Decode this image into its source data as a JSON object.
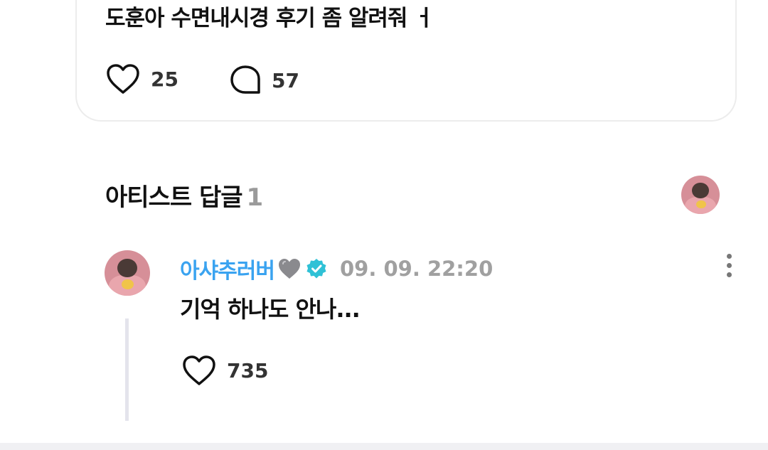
{
  "post": {
    "text": "도훈아 수면내시경 후기 좀 알려줘 ㅓ",
    "like_count": "25",
    "comment_count": "57"
  },
  "artist_replies": {
    "title": "아티스트 답글",
    "count": "1"
  },
  "reply": {
    "author": "아샤추러버",
    "time": "09. 09. 22:20",
    "text": "기억 하나도 안나...",
    "like_count": "735"
  },
  "icons": {
    "like": "heart-outline-icon",
    "comment": "speech-bubble-icon",
    "verified": "verified-badge-icon",
    "more": "vertical-dots-icon",
    "emoji": "grey-heart-icon"
  },
  "colors": {
    "author_name": "#3aa3f0",
    "verified_badge": "#2fc1d6",
    "muted_text": "#a0a0a0"
  }
}
